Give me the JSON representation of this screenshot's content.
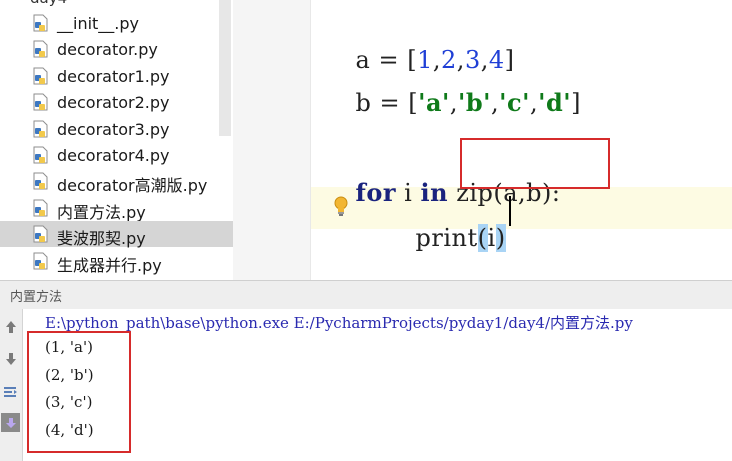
{
  "project_tree": {
    "folder_partial": "day4",
    "files": [
      {
        "name": "__init__.py",
        "selected": false
      },
      {
        "name": "decorator.py",
        "selected": false
      },
      {
        "name": "decorator1.py",
        "selected": false
      },
      {
        "name": "decorator2.py",
        "selected": false
      },
      {
        "name": "decorator3.py",
        "selected": false
      },
      {
        "name": "decorator4.py",
        "selected": false
      },
      {
        "name": "decorator高潮版.py",
        "selected": false
      },
      {
        "name": "内置方法.py",
        "selected": false
      },
      {
        "name": "斐波那契.py",
        "selected": true
      },
      {
        "name": "生成器并行.py",
        "selected": false
      }
    ]
  },
  "editor": {
    "line_a": {
      "var": "a",
      "eq": "=",
      "open": "[",
      "items": [
        "1",
        "2",
        "3",
        "4"
      ],
      "close": "]"
    },
    "line_b": {
      "var": "b",
      "eq": "=",
      "open": "[",
      "items": [
        "'a'",
        "'b'",
        "'c'",
        "'d'"
      ],
      "close": "]"
    },
    "line_for": {
      "kw_for": "for",
      "var": "i",
      "kw_in": "in",
      "call": "zip(a,b)",
      "colon": ":"
    },
    "line_print": {
      "fn": "print",
      "open": "(",
      "arg": "i",
      "close": ")"
    }
  },
  "run_panel": {
    "title": "内置方法",
    "command": "E:\\python_path\\base\\python.exe E:/PycharmProjects/pyday1/day4/内置方法.py",
    "output": [
      "(1, 'a')",
      "(2, 'b')",
      "(3, 'c')",
      "(4, 'd')"
    ],
    "toolbar": [
      "up-arrow-icon",
      "down-arrow-icon",
      "soft-wrap-icon",
      "scroll-to-end-icon"
    ]
  },
  "colors": {
    "number": "#1f3fd6",
    "string": "#0f7a1a",
    "keyword": "#1a237e",
    "highlight_box": "#d62b2b",
    "current_line": "#fdfbe3",
    "selected_file": "#d5d5d5"
  }
}
